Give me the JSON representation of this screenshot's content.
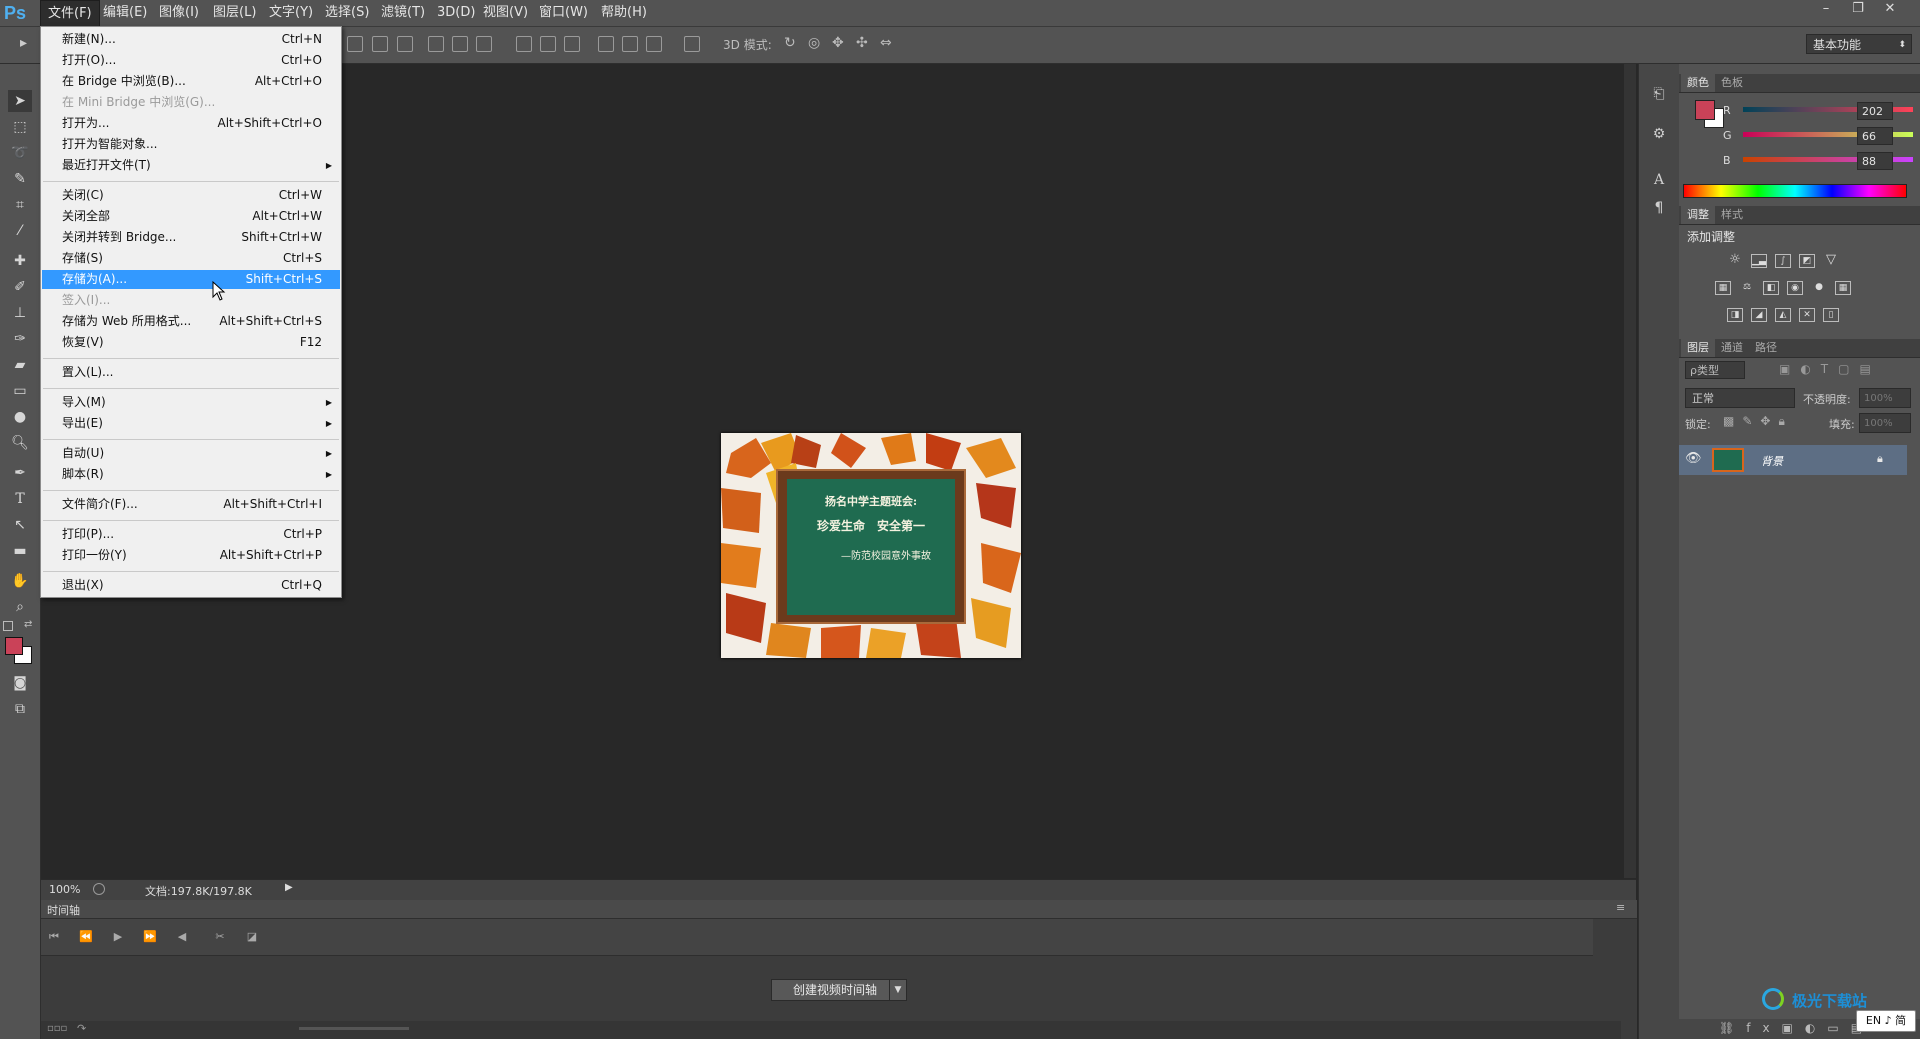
{
  "app": {
    "logo": "Ps"
  },
  "menubar": {
    "items": [
      "文件(F)",
      "编辑(E)",
      "图像(I)",
      "图层(L)",
      "文字(Y)",
      "选择(S)",
      "滤镜(T)",
      "3D(D)",
      "视图(V)",
      "窗口(W)",
      "帮助(H)"
    ],
    "active_index": 0
  },
  "window_controls": {
    "minimize": "–",
    "restore": "❐",
    "close": "✕"
  },
  "options": {
    "mode_label": "3D 模式:",
    "workspace": "基本功能"
  },
  "file_menu": {
    "items": [
      {
        "label": "新建(N)...",
        "shortcut": "Ctrl+N"
      },
      {
        "label": "打开(O)...",
        "shortcut": "Ctrl+O"
      },
      {
        "label": "在 Bridge 中浏览(B)...",
        "shortcut": "Alt+Ctrl+O"
      },
      {
        "label": "在 Mini Bridge 中浏览(G)...",
        "shortcut": "",
        "disabled": true
      },
      {
        "label": "打开为...",
        "shortcut": "Alt+Shift+Ctrl+O"
      },
      {
        "label": "打开为智能对象...",
        "shortcut": ""
      },
      {
        "label": "最近打开文件(T)",
        "shortcut": "",
        "submenu": true
      },
      {
        "label": "关闭(C)",
        "shortcut": "Ctrl+W"
      },
      {
        "label": "关闭全部",
        "shortcut": "Alt+Ctrl+W"
      },
      {
        "label": "关闭并转到 Bridge...",
        "shortcut": "Shift+Ctrl+W"
      },
      {
        "label": "存储(S)",
        "shortcut": "Ctrl+S"
      },
      {
        "label": "存储为(A)...",
        "shortcut": "Shift+Ctrl+S",
        "selected": true
      },
      {
        "label": "签入(I)...",
        "shortcut": "",
        "disabled": true
      },
      {
        "label": "存储为 Web 所用格式...",
        "shortcut": "Alt+Shift+Ctrl+S"
      },
      {
        "label": "恢复(V)",
        "shortcut": "F12"
      },
      {
        "label": "置入(L)...",
        "shortcut": ""
      },
      {
        "label": "导入(M)",
        "shortcut": "",
        "submenu": true
      },
      {
        "label": "导出(E)",
        "shortcut": "",
        "submenu": true
      },
      {
        "label": "自动(U)",
        "shortcut": "",
        "submenu": true
      },
      {
        "label": "脚本(R)",
        "shortcut": "",
        "submenu": true
      },
      {
        "label": "文件简介(F)...",
        "shortcut": "Alt+Shift+Ctrl+I"
      },
      {
        "label": "打印(P)...",
        "shortcut": "Ctrl+P"
      },
      {
        "label": "打印一份(Y)",
        "shortcut": "Alt+Shift+Ctrl+P"
      },
      {
        "label": "退出(X)",
        "shortcut": "Ctrl+Q"
      }
    ]
  },
  "canvas_image": {
    "line1": "扬名中学主题班会:",
    "line2": "珍爱生命　安全第一",
    "line3": "—防范校园意外事故"
  },
  "status": {
    "zoom": "100%",
    "doc_info": "文档:197.8K/197.8K"
  },
  "timeline": {
    "title": "时间轴",
    "create_button": "创建视频时间轴"
  },
  "color_panel": {
    "tabs": [
      "颜色",
      "色板"
    ],
    "channels": [
      {
        "name": "R",
        "value": "202"
      },
      {
        "name": "G",
        "value": "66"
      },
      {
        "name": "B",
        "value": "88"
      }
    ],
    "foreground": "#ca4258",
    "background": "#ffffff"
  },
  "adjust_panel": {
    "tabs": [
      "调整",
      "样式"
    ],
    "heading": "添加调整"
  },
  "layers_panel": {
    "tabs": [
      "图层",
      "通道",
      "路径"
    ],
    "filter": "ρ类型",
    "blend_mode": "正常",
    "opacity_label": "不透明度:",
    "opacity_value": "100%",
    "lock_label": "锁定:",
    "fill_label": "填充:",
    "fill_value": "100%",
    "layer_name": "背景"
  },
  "watermark": {
    "text": "极光下载站"
  },
  "ime": {
    "text": "EN ♪ 简"
  }
}
